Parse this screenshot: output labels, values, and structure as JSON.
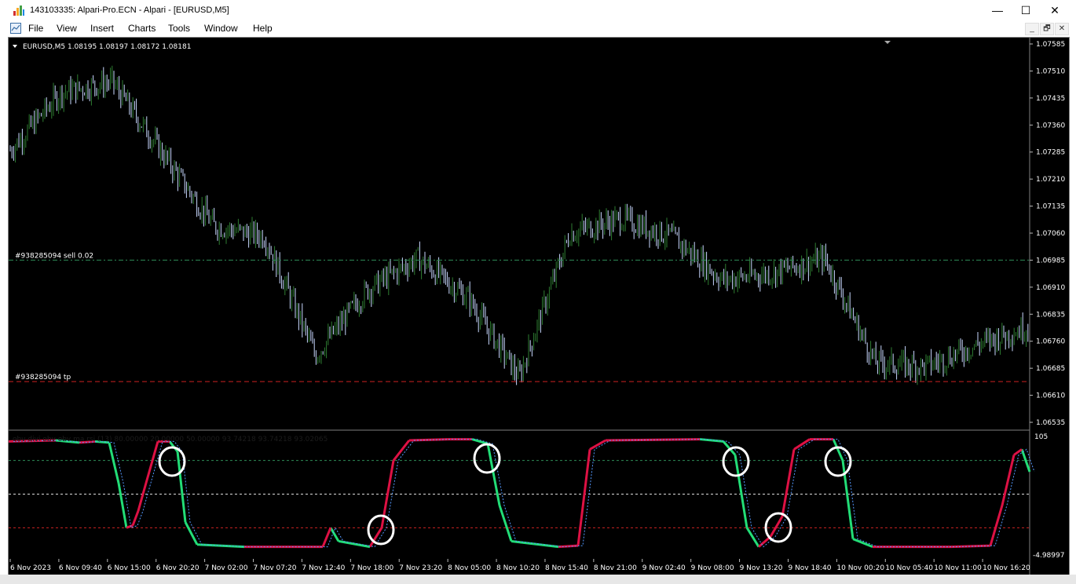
{
  "window": {
    "title": "143103335: Alpari-Pro.ECN - Alpari - [EURUSD,M5]",
    "minimize_glyph": "—",
    "maximize_glyph": "☐",
    "close_glyph": "✕"
  },
  "menu": {
    "items": [
      "File",
      "View",
      "Insert",
      "Charts",
      "Tools",
      "Window",
      "Help"
    ]
  },
  "mdi": {
    "minimize": "_",
    "restore": "🗗",
    "close": "✕"
  },
  "chart": {
    "info": "EURUSD,M5  1.08195 1.08197 1.08172 1.08181",
    "colors": {
      "background": "#000000",
      "bull": "#2e7d32",
      "bear": "#c8d8ff",
      "grid": "#4a4a4a",
      "sell_line": "#2e8b57",
      "tp_line": "#cc2222"
    },
    "orders": {
      "sell": {
        "label": "#938285094 sell 0.02",
        "price": 1.06985
      },
      "tp": {
        "label": "#938285094 tp",
        "price": 1.06648
      }
    },
    "price_axis": [
      "1.07585",
      "1.07510",
      "1.07435",
      "1.07360",
      "1.07285",
      "1.07210",
      "1.07135",
      "1.07060",
      "1.06985",
      "1.06910",
      "1.06835",
      "1.06760",
      "1.06685",
      "1.06610",
      "1.06535"
    ],
    "time_axis": [
      "6 Nov 2023",
      "6 Nov 09:40",
      "6 Nov 15:00",
      "6 Nov 20:20",
      "7 Nov 02:00",
      "7 Nov 07:20",
      "7 Nov 12:40",
      "7 Nov 18:00",
      "7 Nov 23:20",
      "8 Nov 05:00",
      "8 Nov 10:20",
      "8 Nov 15:40",
      "8 Nov 21:00",
      "9 Nov 02:40",
      "9 Nov 08:00",
      "9 Nov 13:20",
      "9 Nov 18:40",
      "10 Nov 00:20",
      "10 Nov 05:40",
      "10 Nov 11:00",
      "10 Nov 16:20"
    ]
  },
  "indicator": {
    "label": "obv divi obv obv ma rsi (13) 80.00000 20.00000 50.00000 93.74218 93.74218 93.02065",
    "scale_top": "105",
    "scale_bottom": "-4.98997",
    "levels": [
      80,
      50,
      20
    ],
    "colors": {
      "up": "#22dd77",
      "down": "#dd1144",
      "signal": "#5599ff",
      "level_80": "#2e8b57",
      "level_50": "#dddddd",
      "level_20": "#cc2222"
    }
  },
  "chart_data": {
    "type": "line",
    "title": "",
    "xlabel": "",
    "ylabel": "",
    "ylim": [
      1.06535,
      1.07585
    ],
    "x": [
      "6 Nov 2023",
      "6 Nov 09:40",
      "6 Nov 15:00",
      "6 Nov 20:20",
      "7 Nov 02:00",
      "7 Nov 07:20",
      "7 Nov 12:40",
      "7 Nov 18:00",
      "7 Nov 23:20",
      "8 Nov 05:00",
      "8 Nov 10:20",
      "8 Nov 15:40",
      "8 Nov 21:00",
      "9 Nov 02:40",
      "9 Nov 08:00",
      "9 Nov 13:20",
      "9 Nov 18:40",
      "10 Nov 00:20",
      "10 Nov 05:40",
      "10 Nov 11:00",
      "10 Nov 16:20"
    ],
    "series": [
      {
        "values": [
          1.0729,
          1.0745,
          1.0748,
          1.0728,
          1.0708,
          1.0705,
          1.0672,
          1.069,
          1.0699,
          1.0688,
          1.0666,
          1.0706,
          1.071,
          1.0705,
          1.0693,
          1.0695,
          1.0699,
          1.067,
          1.0669,
          1.0675,
          1.068
        ]
      }
    ]
  }
}
